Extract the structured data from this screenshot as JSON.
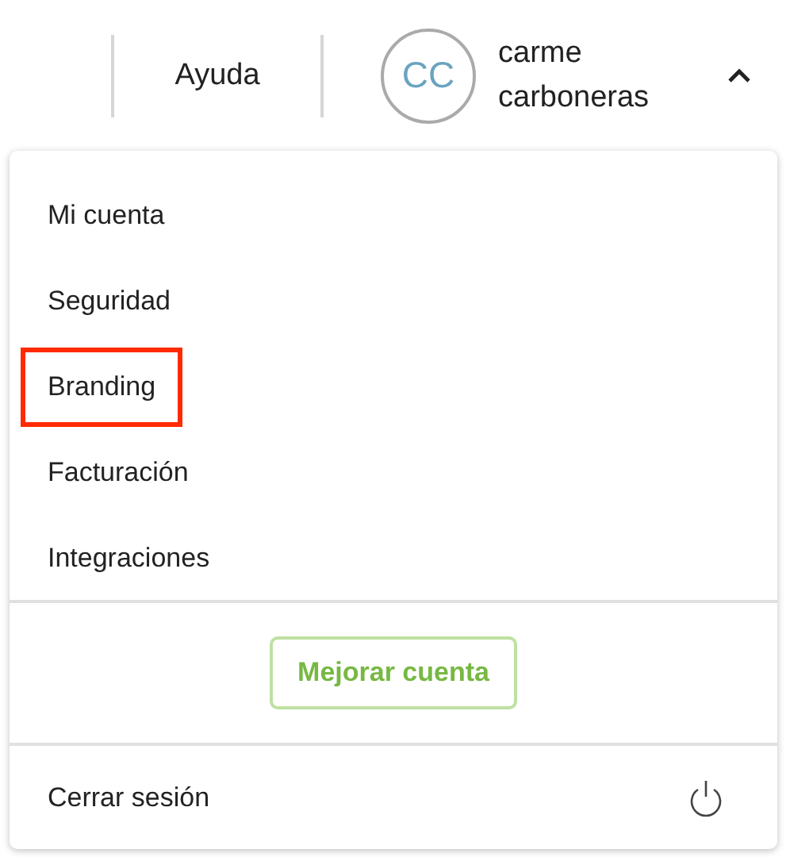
{
  "header": {
    "help_link": "Ayuda",
    "user": {
      "initials": "CC",
      "name_line_1": "carme",
      "name_line_2": "carboneras"
    },
    "menu_expanded": true
  },
  "menu": {
    "items": [
      {
        "label": "Mi cuenta",
        "highlighted": false
      },
      {
        "label": "Seguridad",
        "highlighted": false
      },
      {
        "label": "Branding",
        "highlighted": true
      },
      {
        "label": "Facturación",
        "highlighted": false
      },
      {
        "label": "Integraciones",
        "highlighted": false
      }
    ],
    "upgrade_button": "Mejorar cuenta",
    "logout": "Cerrar sesión"
  }
}
